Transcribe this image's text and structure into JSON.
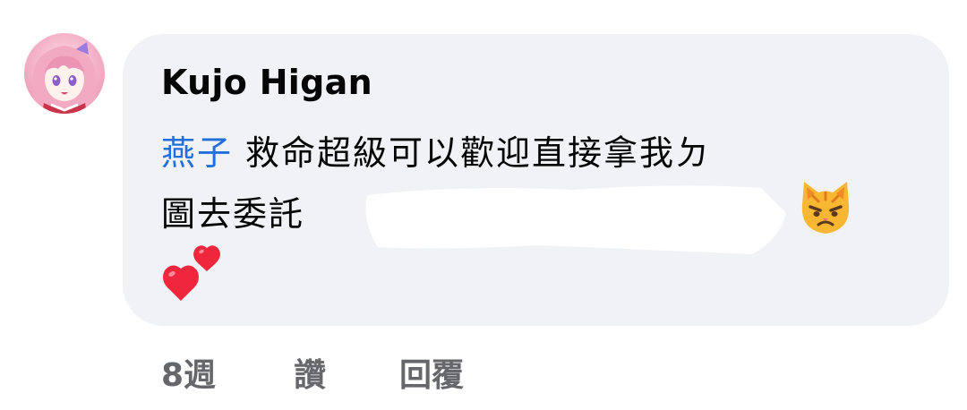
{
  "comment": {
    "author": "Kujo Higan",
    "mention": "燕子",
    "line1_text": "救命超級可以歡迎直接拿我ㄉ",
    "line2_text": "圖去委託",
    "emojis": [
      "pouting-cat-emoji",
      "two-hearts-emoji"
    ]
  },
  "actions": {
    "time": "8週",
    "like": "讚",
    "reply": "回覆"
  },
  "colors": {
    "bubble_bg": "#f0f2f5",
    "mention": "#216fdb",
    "action_text": "#65676b"
  }
}
